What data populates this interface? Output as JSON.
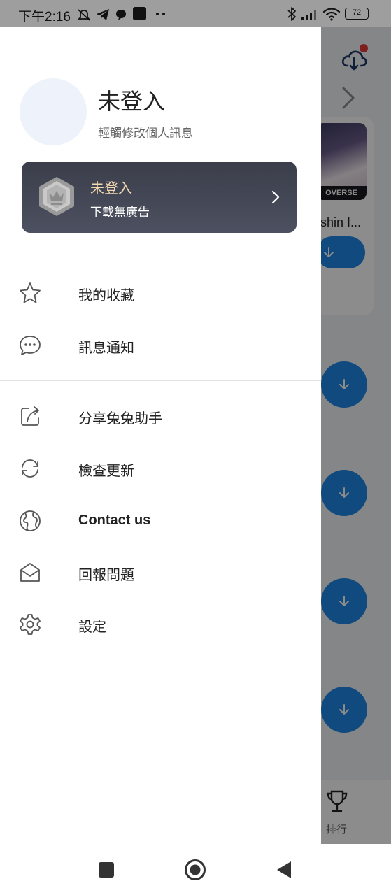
{
  "status_bar": {
    "time": "下午2:16",
    "battery": "72",
    "icons": [
      "mute-bell-icon",
      "telegram-icon",
      "chat-bubble-icon",
      "app-square-icon",
      "more-dots-icon",
      "bluetooth-icon",
      "signal-icon",
      "wifi-icon",
      "battery-icon"
    ]
  },
  "drawer": {
    "profile": {
      "name": "未登入",
      "hint": "輕觸修改個人訊息"
    },
    "vip_card": {
      "status": "未登入",
      "subtitle": "下載無廣告"
    },
    "menu": [
      {
        "label": "我的收藏",
        "icon": "star-icon"
      },
      {
        "label": "訊息通知",
        "icon": "chat-bubble-icon"
      },
      {
        "label": "分享兔兔助手",
        "icon": "share-icon"
      },
      {
        "label": "檢查更新",
        "icon": "refresh-icon"
      },
      {
        "label": "Contact us",
        "icon": "globe-icon"
      },
      {
        "label": "回報問題",
        "icon": "envelope-icon"
      },
      {
        "label": "設定",
        "icon": "gear-icon"
      }
    ]
  },
  "background_app": {
    "card_title": "shin I...",
    "art_label": "OVERSE",
    "bottom_tab": "排行"
  },
  "colors": {
    "accent_blue": "#1e88e5",
    "vip_gold": "#f3d9b1",
    "vip_card": "#3b3e4a",
    "notification_red": "#e53935"
  }
}
